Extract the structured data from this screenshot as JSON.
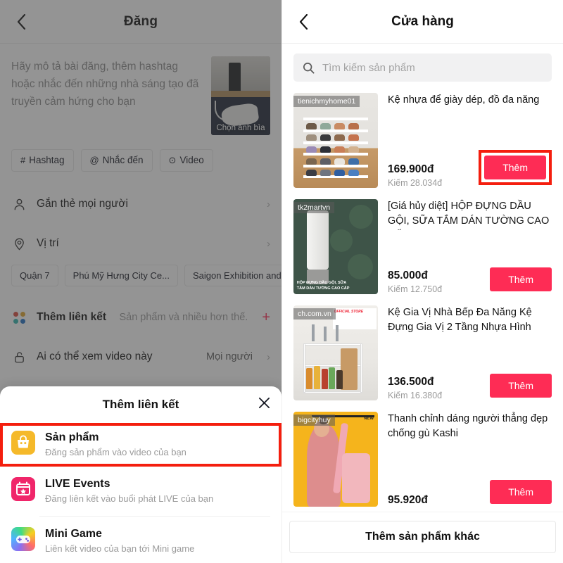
{
  "left": {
    "header": {
      "back_icon": "chevron-left-icon",
      "title": "Đăng"
    },
    "compose": {
      "placeholder": "Hãy mô tả bài đăng, thêm hashtag hoặc nhắc đến những nhà sáng tạo đã truyền cảm hứng cho bạn",
      "cover_label": "Chọn ảnh bìa"
    },
    "quick_chips": [
      {
        "icon": "hashtag-icon",
        "glyph": "#",
        "label": "Hashtag"
      },
      {
        "icon": "at-mention-icon",
        "glyph": "@",
        "label": "Nhắc đến"
      },
      {
        "icon": "video-play-icon",
        "glyph": "⊙",
        "label": "Video"
      }
    ],
    "rows": {
      "tag_people": {
        "icon": "person-icon",
        "label": "Gắn thẻ mọi người",
        "chevron": "›"
      },
      "location": {
        "icon": "location-pin-icon",
        "label": "Vị trí",
        "chevron": "›"
      },
      "add_link": {
        "icon": "four-dots-icon",
        "label": "Thêm liên kết",
        "sub": "Sản phẩm và nhiều hơn thế.",
        "plus": "+",
        "plus_color": "#fe2c55"
      },
      "privacy": {
        "icon": "unlock-icon",
        "label": "Ai có thể xem video này",
        "value": "Mọi người",
        "chevron": "›"
      }
    },
    "place_chips": [
      "Quận 7",
      "Phú Mỹ Hưng City Ce...",
      "Saigon Exhibition and..."
    ],
    "sheet": {
      "title": "Thêm liên kết",
      "close_icon": "close-icon",
      "items": [
        {
          "icon": "shopping-bag-icon",
          "icon_color": "#f5b92a",
          "title": "Sản phẩm",
          "sub": "Đăng sản phẩm vào video của bạn",
          "highlighted": true
        },
        {
          "icon": "calendar-star-icon",
          "icon_color": "#f0266a",
          "title": "LIVE Events",
          "sub": "Đăng liên kết vào buổi phát LIVE của bạn",
          "highlighted": false
        },
        {
          "icon": "gamepad-icon",
          "icon_color": "#8c6ef0",
          "title": "Mini Game",
          "sub": "Liên kết video của bạn tới Mini game",
          "highlighted": false
        }
      ]
    }
  },
  "right": {
    "header": {
      "back_icon": "chevron-left-icon",
      "title": "Cửa hàng"
    },
    "search": {
      "icon": "search-icon",
      "placeholder": "Tìm kiếm sản phẩm",
      "value": ""
    },
    "products": [
      {
        "shop": "tienichmyhome01",
        "name": "Kệ nhựa để giày dép, đồ đa năng",
        "price": "169.900đ",
        "earn": "Kiếm 28.034đ",
        "add_label": "Thêm",
        "highlighted": true
      },
      {
        "shop": "tk2martvn",
        "name": "[Giá hủy diệt] HỘP ĐỰNG DẦU GỘI, SỮA TẮM DÁN TƯỜNG CAO CẤP...",
        "price": "85.000đ",
        "earn": "Kiếm 12.750đ",
        "add_label": "Thêm",
        "highlighted": false
      },
      {
        "shop": "ch.com.vn",
        "name": "Kệ Gia Vị Nhà Bếp Đa Năng Kệ Đựng Gia Vị 2 Tầng Nhựa Hình Chữ...",
        "price": "136.500đ",
        "earn": "Kiếm 16.380đ",
        "add_label": "Thêm",
        "highlighted": false
      },
      {
        "shop": "bigcityhuy",
        "name": "Thanh chỉnh dáng người thẳng đẹp chống gù Kashi",
        "price": "95.920đ",
        "earn": "",
        "add_label": "Thêm",
        "highlighted": false
      }
    ],
    "bottom_button": "Thêm sản phẩm khác"
  },
  "colors": {
    "accent_pink": "#fe2c55",
    "highlight_red": "#f41e0e",
    "toggle_green": "#20c05a",
    "dot_red": "#d94a3d",
    "dot_yellow": "#e0a52b",
    "dot_teal": "#2fb3ad",
    "dot_blue": "#1f6fc4"
  }
}
